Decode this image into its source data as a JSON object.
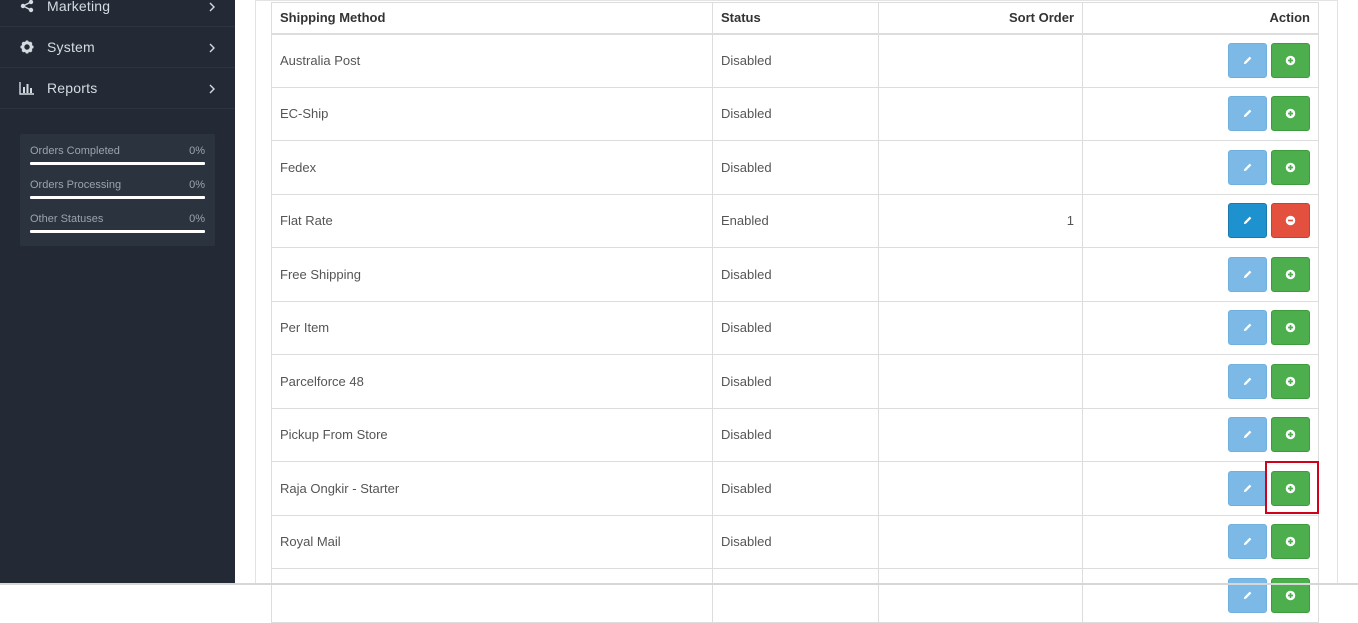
{
  "sidebar": {
    "nav": [
      {
        "label": "Marketing",
        "icon": "share-icon"
      },
      {
        "label": "System",
        "icon": "gear-icon"
      },
      {
        "label": "Reports",
        "icon": "bar-chart-icon"
      }
    ],
    "stats": [
      {
        "label": "Orders Completed",
        "value": "0%",
        "progress": 0
      },
      {
        "label": "Orders Processing",
        "value": "0%",
        "progress": 0
      },
      {
        "label": "Other Statuses",
        "value": "0%",
        "progress": 0
      }
    ]
  },
  "table": {
    "headers": {
      "method": "Shipping Method",
      "status": "Status",
      "sort_order": "Sort Order",
      "action": "Action"
    },
    "rows": [
      {
        "method": "Australia Post",
        "status": "Disabled",
        "sort_order": "",
        "installed": false
      },
      {
        "method": "EC-Ship",
        "status": "Disabled",
        "sort_order": "",
        "installed": false
      },
      {
        "method": "Fedex",
        "status": "Disabled",
        "sort_order": "",
        "installed": false
      },
      {
        "method": "Flat Rate",
        "status": "Enabled",
        "sort_order": "1",
        "installed": true
      },
      {
        "method": "Free Shipping",
        "status": "Disabled",
        "sort_order": "",
        "installed": false
      },
      {
        "method": "Per Item",
        "status": "Disabled",
        "sort_order": "",
        "installed": false
      },
      {
        "method": "Parcelforce 48",
        "status": "Disabled",
        "sort_order": "",
        "installed": false
      },
      {
        "method": "Pickup From Store",
        "status": "Disabled",
        "sort_order": "",
        "installed": false
      },
      {
        "method": "Raja Ongkir - Starter",
        "status": "Disabled",
        "sort_order": "",
        "installed": false
      },
      {
        "method": "Royal Mail",
        "status": "Disabled",
        "sort_order": "",
        "installed": false
      },
      {
        "method": "",
        "status": "",
        "sort_order": "",
        "installed": false
      }
    ]
  },
  "colors": {
    "sidebar_bg": "#232a35",
    "edit_disabled": "#7cb9e6",
    "edit_enabled": "#1e91cf",
    "install": "#4cae4c",
    "uninstall": "#e3503e",
    "highlight": "#d0021b"
  }
}
